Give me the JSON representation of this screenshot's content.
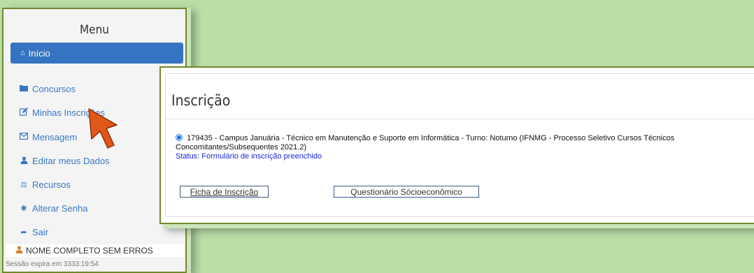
{
  "sidebar": {
    "title": "Menu",
    "active_item": {
      "label": "Início",
      "icon": "home-icon"
    },
    "items": [
      {
        "label": "Concursos",
        "icon": "folder-icon",
        "glyph": "▬"
      },
      {
        "label": "Minhas Inscrições",
        "icon": "edit-icon",
        "glyph": "✎"
      },
      {
        "label": "Mensagem",
        "icon": "envelope-icon",
        "glyph": "✉"
      },
      {
        "label": "Editar meus Dados",
        "icon": "user-icon",
        "glyph": "♟"
      },
      {
        "label": "Recursos",
        "icon": "balance-scale-icon",
        "glyph": "⚖"
      },
      {
        "label": "Alterar Senha",
        "icon": "gear-icon",
        "glyph": "✱"
      },
      {
        "label": "Sair",
        "icon": "sign-out-icon",
        "glyph": "➦"
      }
    ],
    "user_name": "NOME COMPLETO SEM ERROS",
    "session_text": "Sessão expira em 3333:19:54"
  },
  "main": {
    "title": "Inscrição",
    "registration": {
      "text": "179435 - Campus Januária - Técnico em Manutenção e Suporte em Informática - Turno: Noturno (IFNMG - Processo Seletivo Cursos Técnicos Concomitantes/Subsequentes 2021.2)",
      "status": "Status: Formulário de inscrição preenchido",
      "selected": true
    },
    "buttons": {
      "ficha": "Ficha de Inscrição",
      "questionario": "Questionário Sócioeconômico"
    }
  },
  "colors": {
    "background": "#b9dea6",
    "accent": "#3574c0",
    "status": "#1b28d6",
    "cursor": "#e0571a"
  }
}
